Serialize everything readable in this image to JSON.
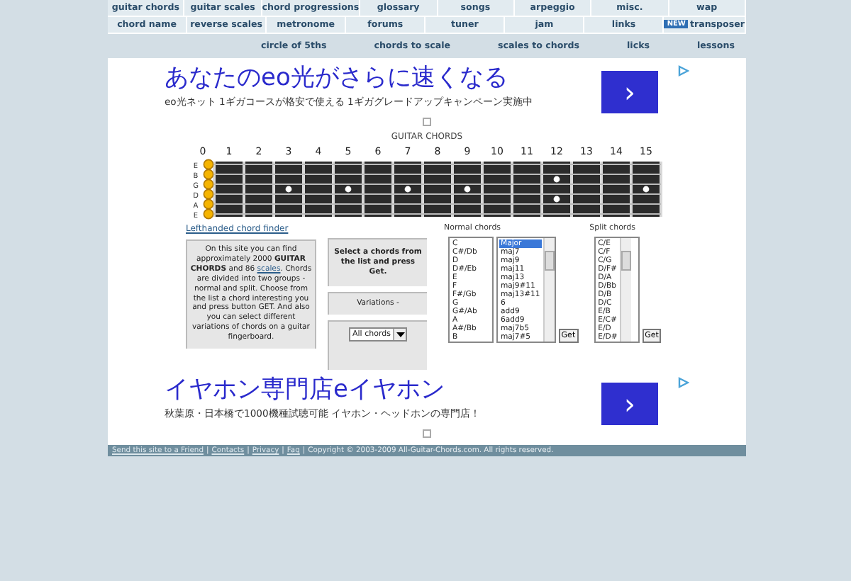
{
  "nav": {
    "rows": [
      [
        "guitar chords",
        "guitar scales",
        "chord progressions",
        "glossary",
        "songs",
        "arpeggio",
        "misc.",
        "wap"
      ],
      [
        "chord name",
        "reverse scales",
        "metronome",
        "forums",
        "tuner",
        "jam",
        "links",
        "transposer"
      ]
    ],
    "badge": "NEW",
    "secondary_links": [
      "circle of 5ths",
      "chords to scale",
      "scales to chords",
      "licks",
      "lessons"
    ]
  },
  "ads": [
    {
      "headline": "あなたのeo光がさらに速くなる",
      "text": "eo光ネット 1ギガコースが格安で使える 1ギガグレードアップキャンペーン実施中",
      "button": "›"
    },
    {
      "headline": "イヤホン専門店eイヤホン",
      "text": "秋葉原・日本橋で1000機種試聴可能 イヤホン・ヘッドホンの専門店！",
      "button": "›"
    }
  ],
  "fretboard": {
    "title": "GUITAR CHORDS",
    "frets": [
      "0",
      "1",
      "2",
      "3",
      "4",
      "5",
      "6",
      "7",
      "8",
      "9",
      "10",
      "11",
      "12",
      "13",
      "14",
      "15"
    ],
    "strings": [
      "E",
      "B",
      "G",
      "D",
      "A",
      "E"
    ]
  },
  "lefthanded_link": "Lefthanded chord finder",
  "info": {
    "before": "On this site you can find approximately 2000 **GUITAR CHORDS** and 86 ",
    "link": "scales",
    "after": ". Chords are divided into two groups - normal and split. Choose from the list a chord interesting you and press button GET. And also you can select different variations of chords on a guitar fingerboard."
  },
  "instruction": "Select a chords from the list and press Get.",
  "variations": "Variations -",
  "variation_select": "All chords",
  "normal": {
    "label": "Normal chords",
    "notes": [
      {
        "text": "C",
        "selected": false
      },
      {
        "text": "C#/Db",
        "selected": false
      },
      {
        "text": "D",
        "selected": false
      },
      {
        "text": "D#/Eb",
        "selected": false
      },
      {
        "text": "E",
        "selected": false
      },
      {
        "text": "F",
        "selected": false
      },
      {
        "text": "F#/Gb",
        "selected": false
      },
      {
        "text": "G",
        "selected": false
      },
      {
        "text": "G#/Ab",
        "selected": false
      },
      {
        "text": "A",
        "selected": false
      },
      {
        "text": "A#/Bb",
        "selected": false
      },
      {
        "text": "B",
        "selected": false
      }
    ],
    "types": [
      {
        "text": "Major",
        "selected": true
      },
      {
        "text": "maj7",
        "selected": false
      },
      {
        "text": "maj9",
        "selected": false
      },
      {
        "text": "maj11",
        "selected": false
      },
      {
        "text": "maj13",
        "selected": false
      },
      {
        "text": "maj9#11",
        "selected": false
      },
      {
        "text": "maj13#11",
        "selected": false
      },
      {
        "text": "6",
        "selected": false
      },
      {
        "text": "add9",
        "selected": false
      },
      {
        "text": "6add9",
        "selected": false
      },
      {
        "text": "maj7b5",
        "selected": false
      },
      {
        "text": "maj7#5",
        "selected": false
      }
    ],
    "button": "Get"
  },
  "split": {
    "label": "Split chords",
    "items": [
      {
        "text": "C/E",
        "selected": false
      },
      {
        "text": "C/F",
        "selected": false
      },
      {
        "text": "C/G",
        "selected": false
      },
      {
        "text": "D/F#",
        "selected": false
      },
      {
        "text": "D/A",
        "selected": false
      },
      {
        "text": "D/Bb",
        "selected": false
      },
      {
        "text": "D/B",
        "selected": false
      },
      {
        "text": "D/C",
        "selected": false
      },
      {
        "text": "E/B",
        "selected": false
      },
      {
        "text": "E/C#",
        "selected": false
      },
      {
        "text": "E/D",
        "selected": false
      },
      {
        "text": "E/D#",
        "selected": false
      }
    ],
    "button": "Get"
  },
  "footer": {
    "links": [
      "Send this site to a Friend",
      "Contacts",
      "Privacy",
      "Faq"
    ],
    "separator": "|",
    "copyright": "Copyright © 2003-2009 All-Guitar-Chords.com. All rights reserved."
  }
}
